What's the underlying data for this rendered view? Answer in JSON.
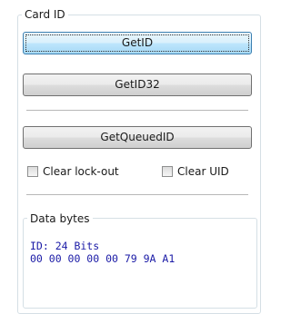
{
  "card_group": {
    "title": "Card ID",
    "buttons": {
      "get_id": "GetID",
      "get_id32": "GetID32",
      "get_queued_id": "GetQueuedID"
    },
    "checkboxes": {
      "clear_lockout": {
        "label": "Clear lock-out",
        "checked": false
      },
      "clear_uid": {
        "label": "Clear UID",
        "checked": false
      }
    }
  },
  "data_group": {
    "title": "Data bytes",
    "lines": [
      "ID: 24 Bits",
      "00 00 00 00 00 79 9A A1"
    ]
  }
}
